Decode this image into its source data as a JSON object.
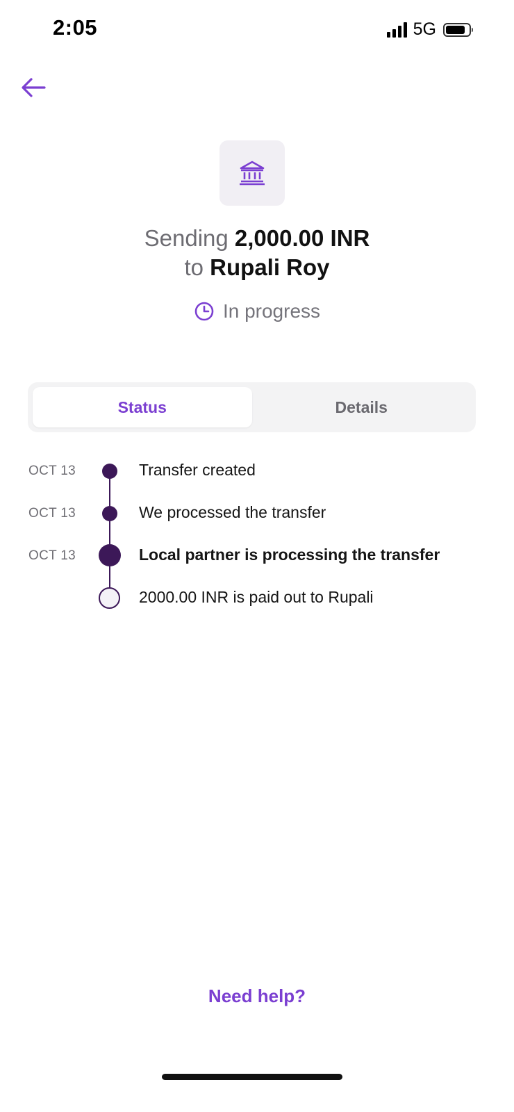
{
  "status_bar": {
    "time": "2:05",
    "network": "5G",
    "signal_bars": 4,
    "battery_level_percent": 85
  },
  "header": {
    "back_icon": "arrow-left-icon"
  },
  "recipient_icon": "bank-icon",
  "summary": {
    "sending_prefix": "Sending",
    "amount": "2,000.00 INR",
    "to_prefix": "to",
    "recipient": "Rupali Roy"
  },
  "progress": {
    "icon": "clock-icon",
    "text": "In progress"
  },
  "tabs": [
    {
      "label": "Status",
      "active": true
    },
    {
      "label": "Details",
      "active": false
    }
  ],
  "timeline": [
    {
      "date": "OCT 13",
      "label": "Transfer created",
      "state": "done"
    },
    {
      "date": "OCT 13",
      "label": "We processed the transfer",
      "state": "done"
    },
    {
      "date": "OCT 13",
      "label": "Local partner is processing the transfer",
      "state": "current"
    },
    {
      "date": "",
      "label": "2000.00 INR is paid out to Rupali",
      "state": "pending"
    }
  ],
  "help": {
    "label": "Need help?"
  },
  "colors": {
    "accent": "#7b3fd1",
    "timeline": "#3c1858",
    "muted_text": "#6d6c72",
    "tile_background": "#f1eff4"
  }
}
